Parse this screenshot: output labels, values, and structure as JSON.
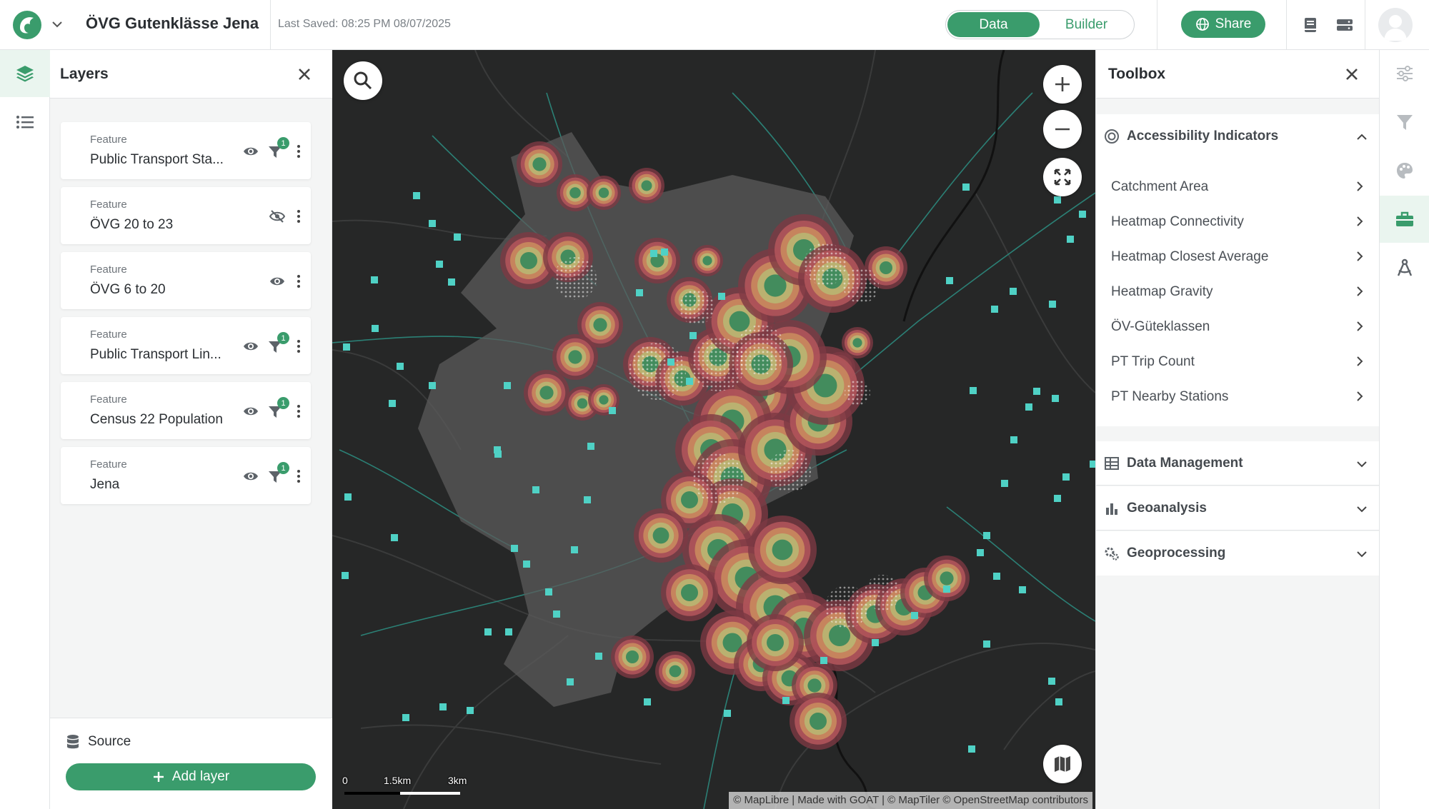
{
  "header": {
    "project_title": "ÖVG Gutenklässe Jena",
    "last_saved": "Last Saved: 08:25 PM 08/07/2025",
    "mode_data": "Data",
    "mode_builder": "Builder",
    "share_label": "Share"
  },
  "layers_panel": {
    "title": "Layers",
    "layers": [
      {
        "type": "Feature",
        "name": "Public Transport Sta...",
        "visible": true,
        "filter_count": "1"
      },
      {
        "type": "Feature",
        "name": "ÖVG 20 to 23",
        "visible": false,
        "filter_count": ""
      },
      {
        "type": "Feature",
        "name": "ÖVG 6 to 20",
        "visible": true,
        "filter_count": ""
      },
      {
        "type": "Feature",
        "name": "Public Transport Lin...",
        "visible": true,
        "filter_count": "1"
      },
      {
        "type": "Feature",
        "name": "Census 22 Population",
        "visible": true,
        "filter_count": "1"
      },
      {
        "type": "Feature",
        "name": "Jena",
        "visible": true,
        "filter_count": "1"
      }
    ],
    "source_label": "Source",
    "add_layer_label": "Add layer"
  },
  "map": {
    "scale_labels": [
      "0",
      "1.5km",
      "3km"
    ],
    "attribution": "© MapLibre | Made with GOAT | © MapTiler © OpenStreetMap contributors"
  },
  "toolbox": {
    "title": "Toolbox",
    "sections": [
      {
        "label": "Accessibility Indicators",
        "expanded": true,
        "items": [
          "Catchment Area",
          "Heatmap Connectivity",
          "Heatmap Closest Average",
          "Heatmap Gravity",
          "ÖV-Güteklassen",
          "PT Trip Count",
          "PT Nearby Stations"
        ]
      },
      {
        "label": "Data Management",
        "expanded": false
      },
      {
        "label": "Geoanalysis",
        "expanded": false
      },
      {
        "label": "Geoprocessing",
        "expanded": false
      }
    ]
  },
  "colors": {
    "brand_green": "#3a9c6c",
    "map_background": "#262727",
    "station_teal": "#4fd1c5"
  }
}
